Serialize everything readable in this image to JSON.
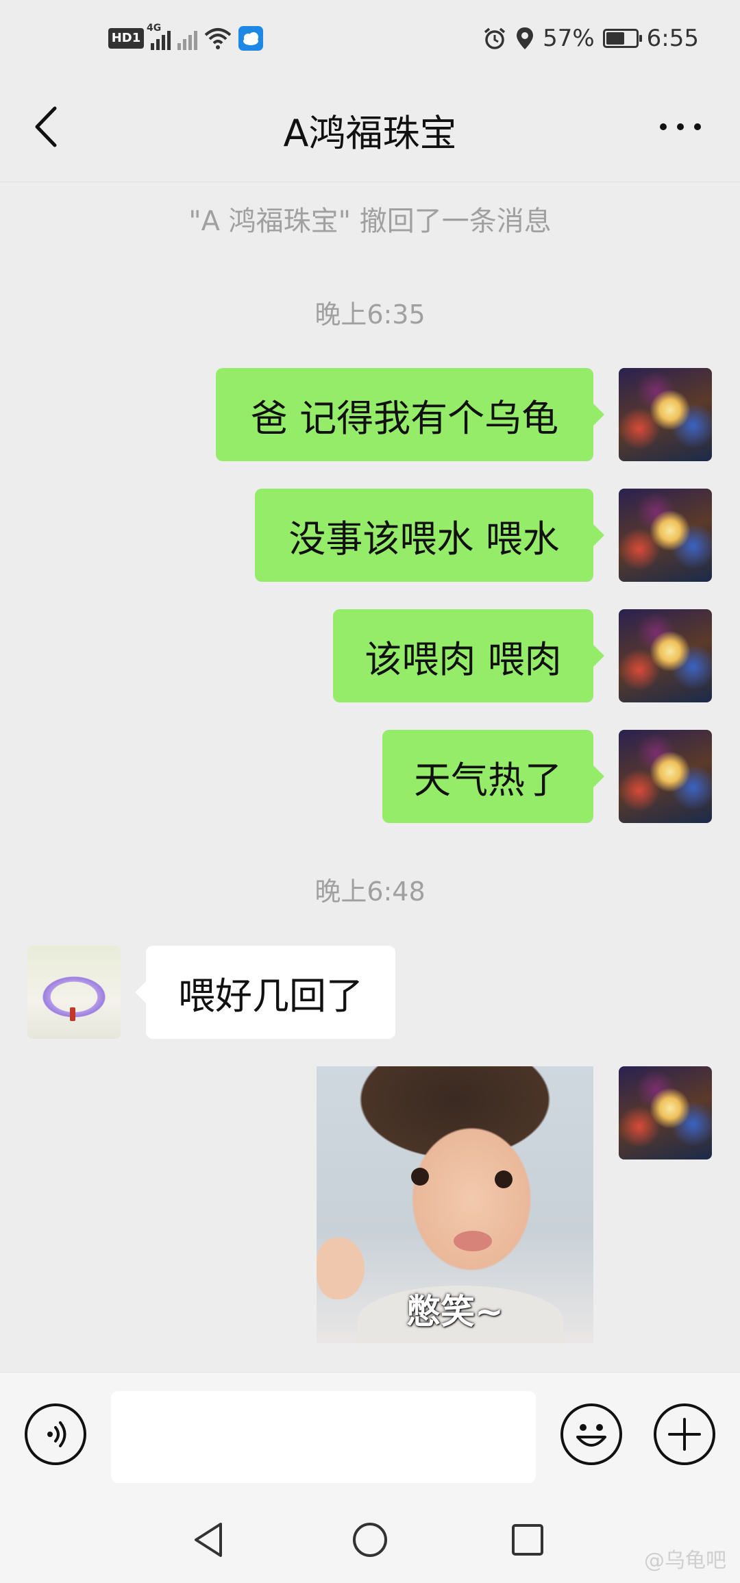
{
  "status_bar": {
    "hd_label": "HD1",
    "network_label": "4G",
    "battery_text": "57%",
    "battery_level": 0.57,
    "time": "6:55",
    "icons": [
      "alarm-icon",
      "location-icon",
      "wifi-icon",
      "weather-icon"
    ]
  },
  "header": {
    "title": "A鸿福珠宝",
    "back_icon": "chevron-left-icon",
    "more_icon": "more-icon"
  },
  "chat": {
    "recall_notice": "\"A 鸿福珠宝\" 撤回了一条消息",
    "timestamp_1": "晚上6:35",
    "timestamp_2": "晚上6:48",
    "messages": [
      {
        "from": "self",
        "text": "爸 记得我有个乌龟"
      },
      {
        "from": "self",
        "text": "没事该喂水 喂水"
      },
      {
        "from": "self",
        "text": "该喂肉 喂肉"
      },
      {
        "from": "self",
        "text": "天气热了"
      },
      {
        "from": "other",
        "text": "喂好几回了"
      },
      {
        "from": "self",
        "type": "sticker",
        "caption": "憋笑~"
      }
    ]
  },
  "input_bar": {
    "voice_icon": "voice-icon",
    "input_value": "",
    "emoji_icon": "emoji-icon",
    "plus_icon": "plus-icon"
  },
  "nav_bar": {
    "icons": [
      "back-triangle-icon",
      "home-circle-icon",
      "recents-square-icon"
    ]
  },
  "watermark": "@乌龟吧",
  "colors": {
    "sent_bubble": "#95ec69",
    "received_bubble": "#ffffff",
    "background": "#ededed"
  }
}
